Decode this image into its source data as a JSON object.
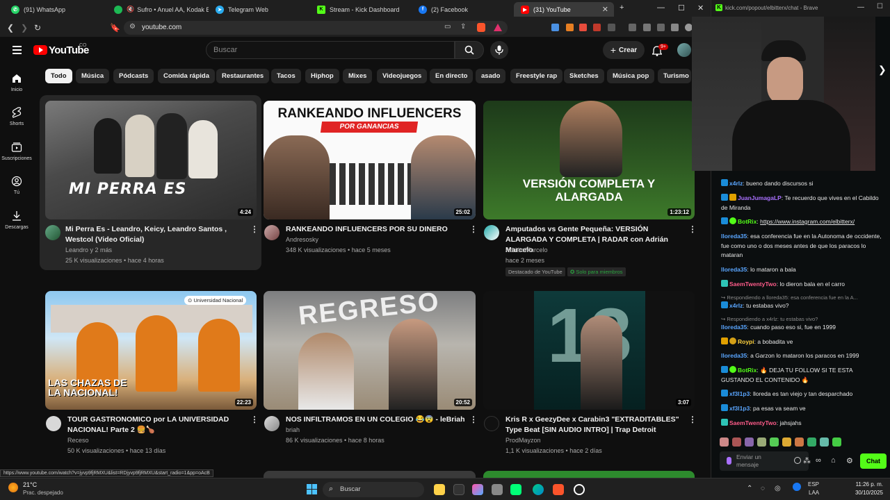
{
  "browser": {
    "tabs": [
      {
        "label": "(91) WhatsApp",
        "icon": "whatsapp-icon",
        "color": "#25d366"
      },
      {
        "label": "Sufro • Anuel AA, Kodak Bla",
        "icon": "spotify-icon",
        "color": "#1db954"
      },
      {
        "label": "Telegram Web",
        "icon": "telegram-icon",
        "color": "#2aabee"
      },
      {
        "label": "Stream - Kick Dashboard",
        "icon": "kick-icon",
        "color": "#53fc18"
      },
      {
        "label": "(2) Facebook",
        "icon": "facebook-icon",
        "color": "#1877f2"
      },
      {
        "label": "(31) YouTube",
        "icon": "youtube-icon",
        "color": "#ff0000"
      }
    ],
    "url": "youtube.com",
    "status_url": "https://www.youtube.com/watch?v=jyvp9fjRMXU&list=RDjyvp9fjRMXU&start_radio=1&pp=oAcB"
  },
  "youtube": {
    "logo_text": "YouTube",
    "logo_country": "CO",
    "search_placeholder": "Buscar",
    "create_label": "Crear",
    "notifications_count": "9+",
    "nav": [
      {
        "label": "Inicio",
        "icon": "home-icon"
      },
      {
        "label": "Shorts",
        "icon": "shorts-icon"
      },
      {
        "label": "Suscripciones",
        "icon": "subscriptions-icon"
      },
      {
        "label": "Tú",
        "icon": "you-icon"
      },
      {
        "label": "Descargas",
        "icon": "downloads-icon"
      }
    ],
    "chips": [
      "Todo",
      "Música",
      "Pódcasts",
      "Comida rápida",
      "Restaurantes",
      "Tacos",
      "Hiphop",
      "Mixes",
      "Videojuegos",
      "En directo",
      "asado",
      "Freestyle rap",
      "Sketches",
      "Música pop",
      "Turismo"
    ],
    "videos": [
      {
        "title": "Mi Perra Es - Leandro, Keicy, Leandro Santos , Westcol (Video Oficial)",
        "channel": "Leandro y 2 más",
        "stats": "25 K visualizaciones • hace 4 horas",
        "duration": "4:24",
        "thumb_text": "MI PERRA ES"
      },
      {
        "title": "RANKEANDO INFLUENCERS POR SU DINERO",
        "channel": "Andresosky",
        "stats": "348 K visualizaciones • hace 5 meses",
        "duration": "25:02",
        "thumb_text": "RANKEANDO INFLUENCERS",
        "thumb_sub": "POR GANANCIAS"
      },
      {
        "title": "Amputados vs Gente Pequeña: VERSIÓN ALARGADA Y COMPLETA | RADAR con Adrián Marcelo",
        "channel": "Adrián Marcelo",
        "stats": "hace 2 meses",
        "duration": "1:23:12",
        "thumb_text": "VERSIÓN COMPLETA Y ALARGADA",
        "badge1": "Destacado de YouTube",
        "badge2": "Solo para miembros"
      },
      {
        "title": "TOUR GASTRONOMICO por LA UNIVERSIDAD NACIONAL!  Parte 2 🍔🍗",
        "channel": "Receso",
        "stats": "50 K visualizaciones • hace 13 días",
        "duration": "22:23",
        "thumb_text": "LAS CHAZAS DE LA NACIONAL!",
        "thumb_tag": "Universidad Nacional"
      },
      {
        "title": "NOS INFILTRAMOS EN UN COLEGIO 😂😨 - leBriah",
        "channel": "briah",
        "stats": "86 K visualizaciones • hace 8 horas",
        "duration": "20:52",
        "thumb_text": "REGRESO"
      },
      {
        "title": "Kris R x GeezyDee x Carabin3 \"EXTRADITABLES\" Type Beat [SIN AUDIO INTRO] | Trap Detroit",
        "channel": "ProdMayzon",
        "stats": "1,1 K visualizaciones • hace 2 días",
        "duration": "3:07",
        "thumb_text": "13"
      }
    ]
  },
  "kick": {
    "window_url": "kick.com/popout/elbitterx/chat - Brave",
    "messages": [
      {
        "user": "x4rlz",
        "text": "bueno dando discursos si",
        "color": "#5aa6ff"
      },
      {
        "user": "JuanJumagaLP",
        "text": "Te recuerdo que vives en el Cabildo de Miranda",
        "color": "#a970ff"
      },
      {
        "user": "BotRix",
        "text": "https://www.instagram.com/elbitterx/",
        "color": "#53fc18"
      },
      {
        "user": "lloreda35",
        "text": "esa conferencia fue en la Autonoma de occidente, fue como uno o dos meses antes de que los paracos lo mataran",
        "color": "#5aa6ff"
      },
      {
        "user": "lloreda35",
        "text": "lo mataron a bala",
        "color": "#5aa6ff"
      },
      {
        "user": "SaemTwentyTwo",
        "text": "lo dieron bala en el carro",
        "color": "#ff5c8a"
      },
      {
        "reply": "Respondiendo a lloreda35: esa conferencia fue en la A..."
      },
      {
        "user": "x4rlz",
        "text": "tu estabas vivo?",
        "color": "#5aa6ff"
      },
      {
        "reply": "Respondiendo a x4rlz: tu estabas vivo?"
      },
      {
        "user": "lloreda35",
        "text": "cuando paso eso si, fue en 1999",
        "color": "#5aa6ff"
      },
      {
        "user": "Roypi",
        "text": "a bobadita ve",
        "color": "#ffd23f"
      },
      {
        "user": "lloreda35",
        "text": "a Garzon lo mataron los paracos en 1999",
        "color": "#5aa6ff"
      },
      {
        "user": "BotRix",
        "text": "🔥 DEJA TU FOLLOW SI TE ESTA GUSTANDO EL CONTENIDO 🔥",
        "color": "#53fc18"
      },
      {
        "user": "xf3l1p3",
        "text": "lloreda es tan viejo y tan desparchado",
        "color": "#5aa6ff"
      },
      {
        "user": "xf3l1p3",
        "text": "pa esas va seam ve",
        "color": "#5aa6ff"
      },
      {
        "user": "SaemTwentyTwo",
        "text": "jahsjahs",
        "color": "#ff5c8a"
      }
    ],
    "input_placeholder": "Enviar un mensaje",
    "chat_button": "Chat"
  },
  "taskbar": {
    "weather_temp": "21°C",
    "weather_desc": "Prac. despejado",
    "search_label": "Buscar",
    "lang": "ESP",
    "lang2": "LAA",
    "time": "11:26 p. m.",
    "date": "30/10/2025"
  }
}
